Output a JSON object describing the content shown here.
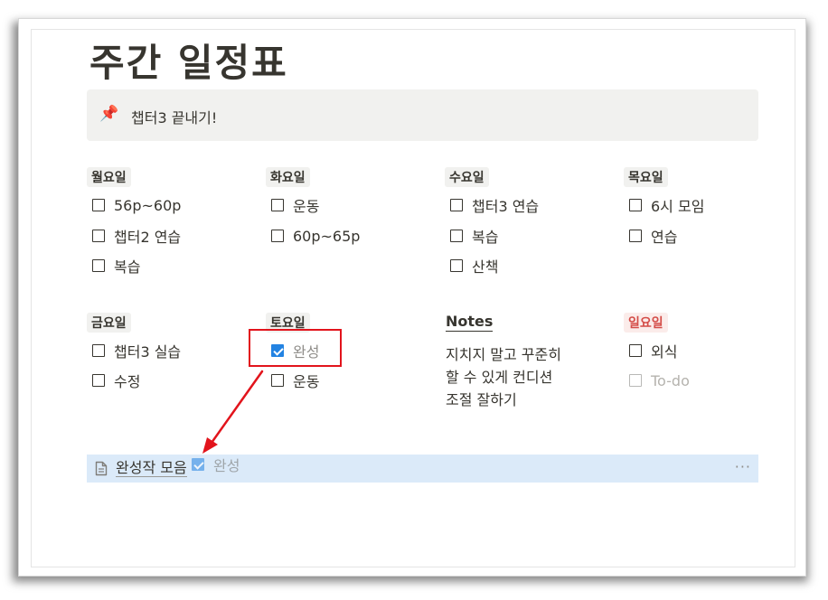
{
  "page": {
    "title": "주간 일정표"
  },
  "callout": {
    "icon": "pushpin-icon",
    "text": "챕터3 끝내기!"
  },
  "days": {
    "mon": {
      "label": "월요일",
      "items": [
        {
          "text": "56p~60p",
          "checked": false
        },
        {
          "text": "챕터2 연습",
          "checked": false
        },
        {
          "text": "복습",
          "checked": false
        }
      ]
    },
    "tue": {
      "label": "화요일",
      "items": [
        {
          "text": "운동",
          "checked": false
        },
        {
          "text": "60p~65p",
          "checked": false
        }
      ]
    },
    "wed": {
      "label": "수요일",
      "items": [
        {
          "text": "챕터3 연습",
          "checked": false
        },
        {
          "text": "복습",
          "checked": false
        },
        {
          "text": "산책",
          "checked": false
        }
      ]
    },
    "thu": {
      "label": "목요일",
      "items": [
        {
          "text": "6시 모임",
          "checked": false
        },
        {
          "text": "연습",
          "checked": false
        }
      ]
    },
    "fri": {
      "label": "금요일",
      "items": [
        {
          "text": "챕터3 실습",
          "checked": false
        },
        {
          "text": "수정",
          "checked": false
        }
      ]
    },
    "sat": {
      "label": "토요일",
      "items": [
        {
          "text": "완성",
          "checked": true
        },
        {
          "text": "운동",
          "checked": false
        }
      ]
    },
    "sun": {
      "label": "일요일",
      "label_color": "#d44c47",
      "items": [
        {
          "text": "외식",
          "checked": false
        }
      ],
      "placeholder": "To-do"
    }
  },
  "notes": {
    "heading": "Notes",
    "lines": [
      "지치지 말고 꾸준히",
      "할 수 있게 컨디션",
      "조절 잘하기"
    ]
  },
  "subpage": {
    "icon": "document-icon",
    "title": "완성작 모음",
    "more": "···"
  },
  "drag_ghost": {
    "text": "완성"
  },
  "colors": {
    "accent_blue": "#2383e2",
    "annotation_red": "#e2141c",
    "row_highlight": "#dbeaf9",
    "callout_bg": "#f1f1ef"
  }
}
